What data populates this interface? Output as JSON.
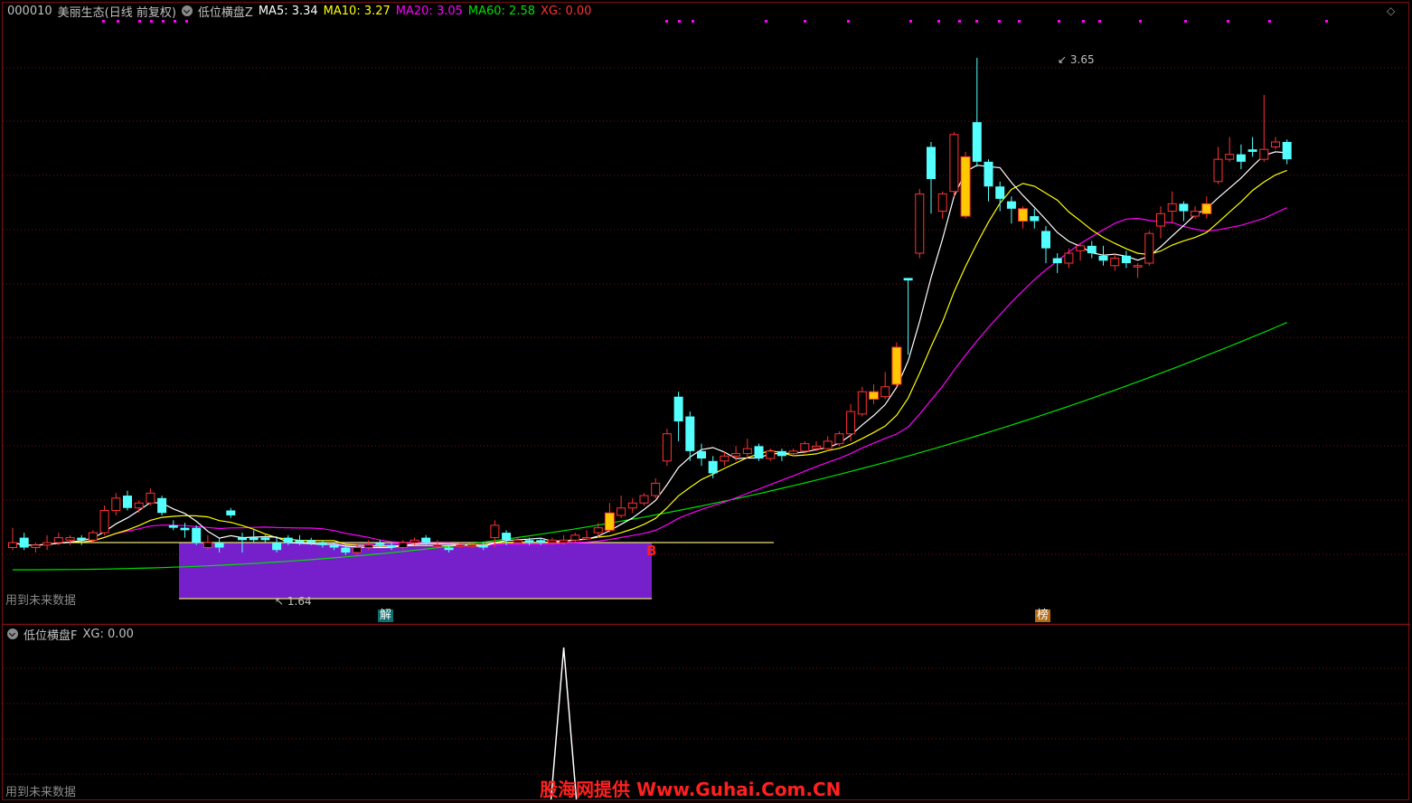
{
  "header": {
    "code": "000010",
    "name": "美丽生态(日线 前复权)",
    "indicator": "低位横盘Z",
    "ma5": "MA5: 3.34",
    "ma10": "MA10: 3.27",
    "ma20": "MA20: 3.05",
    "ma60": "MA60: 2.58",
    "xg": "XG: 0.00"
  },
  "sub_header": {
    "indicator": "低位横盘F",
    "xg": "XG: 0.00"
  },
  "labels": {
    "future_data_top": "用到未来数据",
    "future_data_bottom": "用到未来数据",
    "low_price": "1.64",
    "high_price": "3.65",
    "b_marker": "B",
    "tag_jie": "解",
    "tag_bang": "榜",
    "watermark": "股海网提供 Www.Guhai.Com.CN"
  },
  "colors": {
    "up": "#ff3232",
    "down": "#54ffff",
    "highlight": "#ffc800",
    "ma5": "#ffffff",
    "ma10": "#ffff00",
    "ma20": "#ff00ff",
    "ma60": "#00e000",
    "box": "#7b22d6",
    "grid": "#7a1010"
  },
  "chart_data": {
    "type": "candlestick",
    "price_range": [
      1.5,
      3.65
    ],
    "xg_range": [
      0,
      1
    ],
    "candles": [
      {
        "o": 1.67,
        "c": 1.69,
        "h": 1.75,
        "l": 1.66
      },
      {
        "o": 1.71,
        "c": 1.67,
        "h": 1.73,
        "l": 1.66
      },
      {
        "o": 1.67,
        "c": 1.68,
        "h": 1.69,
        "l": 1.65
      },
      {
        "o": 1.68,
        "c": 1.69,
        "h": 1.72,
        "l": 1.66
      },
      {
        "o": 1.69,
        "c": 1.71,
        "h": 1.73,
        "l": 1.68
      },
      {
        "o": 1.7,
        "c": 1.71,
        "h": 1.72,
        "l": 1.68
      },
      {
        "o": 1.71,
        "c": 1.7,
        "h": 1.72,
        "l": 1.68
      },
      {
        "o": 1.7,
        "c": 1.73,
        "h": 1.74,
        "l": 1.69
      },
      {
        "o": 1.73,
        "c": 1.82,
        "h": 1.84,
        "l": 1.72
      },
      {
        "o": 1.82,
        "c": 1.87,
        "h": 1.89,
        "l": 1.8
      },
      {
        "o": 1.88,
        "c": 1.83,
        "h": 1.9,
        "l": 1.82
      },
      {
        "o": 1.83,
        "c": 1.85,
        "h": 1.86,
        "l": 1.81
      },
      {
        "o": 1.85,
        "c": 1.89,
        "h": 1.91,
        "l": 1.84
      },
      {
        "o": 1.87,
        "c": 1.81,
        "h": 1.88,
        "l": 1.8
      },
      {
        "o": 1.76,
        "c": 1.75,
        "h": 1.78,
        "l": 1.74
      },
      {
        "o": 1.75,
        "c": 1.74,
        "h": 1.77,
        "l": 1.71
      },
      {
        "o": 1.75,
        "c": 1.69,
        "h": 1.76,
        "l": 1.68
      },
      {
        "o": 1.67,
        "c": 1.69,
        "h": 1.72,
        "l": 1.66
      },
      {
        "o": 1.69,
        "c": 1.67,
        "h": 1.71,
        "l": 1.65
      },
      {
        "o": 1.82,
        "c": 1.8,
        "h": 1.83,
        "l": 1.79
      },
      {
        "o": 1.71,
        "c": 1.7,
        "h": 1.73,
        "l": 1.65
      },
      {
        "o": 1.71,
        "c": 1.7,
        "h": 1.74,
        "l": 1.69
      },
      {
        "o": 1.71,
        "c": 1.7,
        "h": 1.72,
        "l": 1.69
      },
      {
        "o": 1.69,
        "c": 1.66,
        "h": 1.71,
        "l": 1.65
      },
      {
        "o": 1.71,
        "c": 1.69,
        "h": 1.72,
        "l": 1.68
      },
      {
        "o": 1.7,
        "c": 1.69,
        "h": 1.72,
        "l": 1.68
      },
      {
        "o": 1.7,
        "c": 1.69,
        "h": 1.71,
        "l": 1.68
      },
      {
        "o": 1.69,
        "c": 1.68,
        "h": 1.7,
        "l": 1.67
      },
      {
        "o": 1.68,
        "c": 1.67,
        "h": 1.69,
        "l": 1.66
      },
      {
        "o": 1.67,
        "c": 1.65,
        "h": 1.68,
        "l": 1.64
      },
      {
        "o": 1.65,
        "c": 1.67,
        "h": 1.69,
        "l": 1.64
      },
      {
        "o": 1.67,
        "c": 1.68,
        "h": 1.7,
        "l": 1.66
      },
      {
        "o": 1.69,
        "c": 1.68,
        "h": 1.7,
        "l": 1.67
      },
      {
        "o": 1.68,
        "c": 1.67,
        "h": 1.69,
        "l": 1.66
      },
      {
        "o": 1.67,
        "c": 1.69,
        "h": 1.7,
        "l": 1.66
      },
      {
        "o": 1.69,
        "c": 1.7,
        "h": 1.71,
        "l": 1.68
      },
      {
        "o": 1.71,
        "c": 1.69,
        "h": 1.72,
        "l": 1.68
      },
      {
        "o": 1.68,
        "c": 1.68,
        "h": 1.7,
        "l": 1.67
      },
      {
        "o": 1.67,
        "c": 1.66,
        "h": 1.68,
        "l": 1.65
      },
      {
        "o": 1.68,
        "c": 1.68,
        "h": 1.69,
        "l": 1.67
      },
      {
        "o": 1.68,
        "c": 1.68,
        "h": 1.69,
        "l": 1.67
      },
      {
        "o": 1.68,
        "c": 1.67,
        "h": 1.69,
        "l": 1.66
      },
      {
        "o": 1.71,
        "c": 1.76,
        "h": 1.78,
        "l": 1.67
      },
      {
        "o": 1.73,
        "c": 1.7,
        "h": 1.74,
        "l": 1.68
      },
      {
        "o": 1.69,
        "c": 1.7,
        "h": 1.71,
        "l": 1.68
      },
      {
        "o": 1.7,
        "c": 1.69,
        "h": 1.71,
        "l": 1.68
      },
      {
        "o": 1.7,
        "c": 1.69,
        "h": 1.71,
        "l": 1.68
      },
      {
        "o": 1.69,
        "c": 1.7,
        "h": 1.71,
        "l": 1.68
      },
      {
        "o": 1.69,
        "c": 1.7,
        "h": 1.72,
        "l": 1.68
      },
      {
        "o": 1.7,
        "c": 1.72,
        "h": 1.73,
        "l": 1.69
      },
      {
        "o": 1.71,
        "c": 1.71,
        "h": 1.74,
        "l": 1.7
      },
      {
        "o": 1.73,
        "c": 1.75,
        "h": 1.77,
        "l": 1.71
      },
      {
        "o": 1.74,
        "c": 1.81,
        "h": 1.85,
        "l": 1.73
      },
      {
        "o": 1.8,
        "c": 1.83,
        "h": 1.88,
        "l": 1.79
      },
      {
        "o": 1.83,
        "c": 1.85,
        "h": 1.87,
        "l": 1.81
      },
      {
        "o": 1.85,
        "c": 1.88,
        "h": 1.89,
        "l": 1.84
      },
      {
        "o": 1.88,
        "c": 1.93,
        "h": 1.95,
        "l": 1.87
      },
      {
        "o": 2.02,
        "c": 2.13,
        "h": 2.15,
        "l": 2.0
      },
      {
        "o": 2.28,
        "c": 2.18,
        "h": 2.3,
        "l": 2.1
      },
      {
        "o": 2.2,
        "c": 2.06,
        "h": 2.22,
        "l": 2.02
      },
      {
        "o": 2.06,
        "c": 2.03,
        "h": 2.09,
        "l": 2.0
      },
      {
        "o": 2.02,
        "c": 1.97,
        "h": 2.04,
        "l": 1.95
      },
      {
        "o": 2.02,
        "c": 2.04,
        "h": 2.06,
        "l": 2.0
      },
      {
        "o": 2.04,
        "c": 2.05,
        "h": 2.08,
        "l": 2.02
      },
      {
        "o": 2.05,
        "c": 2.07,
        "h": 2.11,
        "l": 2.03
      },
      {
        "o": 2.08,
        "c": 2.03,
        "h": 2.09,
        "l": 2.02
      },
      {
        "o": 2.03,
        "c": 2.06,
        "h": 2.07,
        "l": 2.02
      },
      {
        "o": 2.06,
        "c": 2.04,
        "h": 2.07,
        "l": 2.02
      },
      {
        "o": 2.05,
        "c": 2.06,
        "h": 2.07,
        "l": 2.04
      },
      {
        "o": 2.06,
        "c": 2.09,
        "h": 2.1,
        "l": 2.05
      },
      {
        "o": 2.07,
        "c": 2.08,
        "h": 2.1,
        "l": 2.06
      },
      {
        "o": 2.07,
        "c": 2.1,
        "h": 2.12,
        "l": 2.06
      },
      {
        "o": 2.09,
        "c": 2.13,
        "h": 2.14,
        "l": 2.08
      },
      {
        "o": 2.13,
        "c": 2.22,
        "h": 2.25,
        "l": 2.1
      },
      {
        "o": 2.21,
        "c": 2.3,
        "h": 2.32,
        "l": 2.2
      },
      {
        "o": 2.3,
        "c": 2.27,
        "h": 2.33,
        "l": 2.25
      },
      {
        "o": 2.28,
        "c": 2.32,
        "h": 2.38,
        "l": 2.27
      },
      {
        "o": 2.33,
        "c": 2.48,
        "h": 2.5,
        "l": 2.32
      },
      {
        "o": 2.76,
        "c": 2.75,
        "h": 2.76,
        "l": 2.45
      },
      {
        "o": 2.86,
        "c": 3.1,
        "h": 3.12,
        "l": 2.84
      },
      {
        "o": 3.29,
        "c": 3.16,
        "h": 3.31,
        "l": 3.02
      },
      {
        "o": 3.03,
        "c": 3.1,
        "h": 3.11,
        "l": 3.0
      },
      {
        "o": 3.11,
        "c": 3.34,
        "h": 3.35,
        "l": 3.09
      },
      {
        "o": 3.01,
        "c": 3.25,
        "h": 3.27,
        "l": 3.0
      },
      {
        "o": 3.39,
        "c": 3.23,
        "h": 3.65,
        "l": 3.21
      },
      {
        "o": 3.23,
        "c": 3.13,
        "h": 3.24,
        "l": 3.07
      },
      {
        "o": 3.13,
        "c": 3.08,
        "h": 3.15,
        "l": 3.03
      },
      {
        "o": 3.07,
        "c": 3.04,
        "h": 3.09,
        "l": 2.98
      },
      {
        "o": 3.04,
        "c": 2.99,
        "h": 3.05,
        "l": 2.96
      },
      {
        "o": 3.01,
        "c": 2.99,
        "h": 3.04,
        "l": 2.96
      },
      {
        "o": 2.95,
        "c": 2.88,
        "h": 2.97,
        "l": 2.82
      },
      {
        "o": 2.84,
        "c": 2.82,
        "h": 2.86,
        "l": 2.78
      },
      {
        "o": 2.82,
        "c": 2.86,
        "h": 2.88,
        "l": 2.8
      },
      {
        "o": 2.87,
        "c": 2.89,
        "h": 2.9,
        "l": 2.83
      },
      {
        "o": 2.89,
        "c": 2.86,
        "h": 2.91,
        "l": 2.84
      },
      {
        "o": 2.85,
        "c": 2.83,
        "h": 2.89,
        "l": 2.81
      },
      {
        "o": 2.81,
        "c": 2.84,
        "h": 2.86,
        "l": 2.79
      },
      {
        "o": 2.85,
        "c": 2.82,
        "h": 2.87,
        "l": 2.8
      },
      {
        "o": 2.81,
        "c": 2.81,
        "h": 2.82,
        "l": 2.76
      },
      {
        "o": 2.82,
        "c": 2.94,
        "h": 2.95,
        "l": 2.81
      },
      {
        "o": 2.97,
        "c": 3.02,
        "h": 3.05,
        "l": 2.92
      },
      {
        "o": 3.03,
        "c": 3.06,
        "h": 3.11,
        "l": 2.98
      },
      {
        "o": 3.06,
        "c": 3.03,
        "h": 3.07,
        "l": 2.99
      },
      {
        "o": 3.01,
        "c": 3.03,
        "h": 3.05,
        "l": 3.0
      },
      {
        "o": 3.02,
        "c": 3.06,
        "h": 3.09,
        "l": 3.0
      },
      {
        "o": 3.15,
        "c": 3.24,
        "h": 3.29,
        "l": 3.14
      },
      {
        "o": 3.24,
        "c": 3.26,
        "h": 3.33,
        "l": 3.23
      },
      {
        "o": 3.26,
        "c": 3.23,
        "h": 3.3,
        "l": 3.2
      },
      {
        "o": 3.28,
        "c": 3.27,
        "h": 3.33,
        "l": 3.25
      },
      {
        "o": 3.24,
        "c": 3.28,
        "h": 3.5,
        "l": 3.23
      },
      {
        "o": 3.29,
        "c": 3.31,
        "h": 3.33,
        "l": 3.28
      },
      {
        "o": 3.31,
        "c": 3.24,
        "h": 3.32,
        "l": 3.22
      }
    ],
    "highlight_days": [
      52,
      75,
      77,
      83,
      88,
      104
    ],
    "xg": {
      "spike_index": 48,
      "value": 1
    },
    "ma60_anchor": [
      1.58,
      2.58
    ]
  }
}
